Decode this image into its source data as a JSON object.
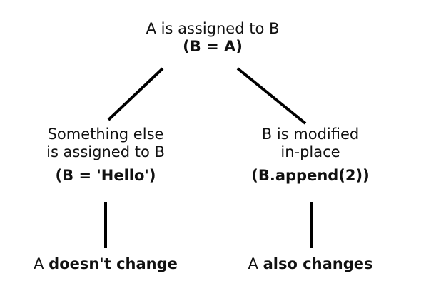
{
  "root": {
    "line1": "A is assigned to B",
    "line2": "(B = A)"
  },
  "left": {
    "line1": "Something else",
    "line2": "is assigned to B",
    "code": "(B = 'Hello')",
    "result_prefix": "A",
    "result_bold": "doesn't change"
  },
  "right": {
    "line1": "B is modified",
    "line2": "in-place",
    "code": "(B.append(2))",
    "result_prefix": "A",
    "result_bold": "also changes"
  },
  "colors": {
    "text": "#111111",
    "line": "#000000",
    "background": "#ffffff"
  }
}
